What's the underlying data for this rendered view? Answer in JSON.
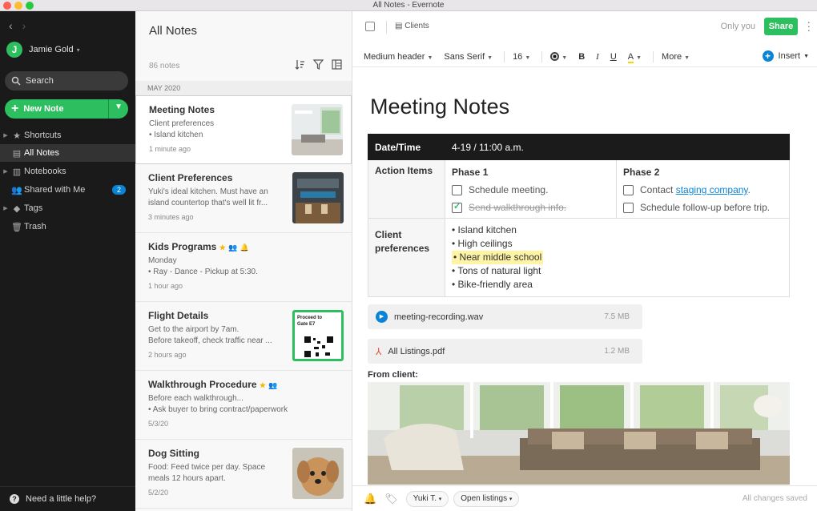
{
  "window": {
    "title": "All Notes - Evernote"
  },
  "sidebar": {
    "user": {
      "initial": "J",
      "name": "Jamie Gold"
    },
    "search_label": "Search",
    "new_note_label": "New Note",
    "items": [
      {
        "label": "Shortcuts",
        "icon": "star-icon"
      },
      {
        "label": "All Notes",
        "icon": "notes-icon"
      },
      {
        "label": "Notebooks",
        "icon": "notebook-icon"
      },
      {
        "label": "Shared with Me",
        "icon": "people-icon",
        "badge": "2"
      },
      {
        "label": "Tags",
        "icon": "tag-icon"
      },
      {
        "label": "Trash",
        "icon": "trash-icon"
      }
    ],
    "help_label": "Need a little help?"
  },
  "notelist": {
    "title": "All Notes",
    "count": "86 notes",
    "month": "MAY 2020",
    "notes": [
      {
        "title": "Meeting Notes",
        "snippet1": "Client preferences",
        "snippet2": "• Island kitchen",
        "time": "1 minute ago"
      },
      {
        "title": "Client Preferences",
        "snippet1": "Yuki's ideal kitchen. Must have an",
        "snippet2": "island countertop that's well lit fr...",
        "time": "3 minutes ago"
      },
      {
        "title": "Kids Programs",
        "snippet1": "Monday",
        "snippet2": "• Ray - Dance - Pickup at 5:30.",
        "time": "1 hour ago"
      },
      {
        "title": "Flight Details",
        "snippet1": "Get to the airport by 7am.",
        "snippet2": "Before takeoff, check traffic near ...",
        "time": "2 hours ago",
        "ticket_text": "Proceed to Gate E7"
      },
      {
        "title": "Walkthrough Procedure",
        "snippet1": "Before each walkthrough...",
        "snippet2": "•  Ask buyer to bring contract/paperwork",
        "time": "5/3/20"
      },
      {
        "title": "Dog Sitting",
        "snippet1": "Food: Feed twice per day. Space",
        "snippet2": "meals 12 hours apart.",
        "time": "5/2/20"
      }
    ]
  },
  "editor": {
    "notebook": "Clients",
    "visibility": "Only you",
    "share_label": "Share",
    "toolbar": {
      "heading": "Medium header",
      "font": "Sans Serif",
      "size": "16",
      "bold": "B",
      "italic": "I",
      "underline": "U",
      "highlight": "A",
      "more": "More",
      "insert": "Insert"
    },
    "title": "Meeting Notes",
    "table": {
      "header_label": "Date/Time",
      "header_value": "4-19 / 11:00 a.m.",
      "action_label": "Action Items",
      "phase1_title": "Phase 1",
      "phase1_items": [
        {
          "text": "Schedule meeting.",
          "checked": false
        },
        {
          "text": "Send walkthrough info.",
          "checked": true
        }
      ],
      "phase2_title": "Phase 2",
      "phase2_item1_prefix": "Contact ",
      "phase2_item1_link": "staging company",
      "phase2_item1_suffix": ".",
      "phase2_item2": "Schedule follow-up before trip.",
      "pref_label": "Client preferences",
      "prefs": [
        "• Island kitchen",
        "• High ceilings",
        "• Near middle school",
        "• Tons of natural light",
        "• Bike-friendly area"
      ]
    },
    "attachments": [
      {
        "name": "meeting-recording.wav",
        "size": "7.5 MB"
      },
      {
        "name": "All Listings.pdf",
        "size": "1.2 MB"
      }
    ],
    "from_label": "From client:",
    "bottom": {
      "tag1": "Yuki T.",
      "tag2": "Open listings",
      "status": "All changes saved"
    }
  }
}
